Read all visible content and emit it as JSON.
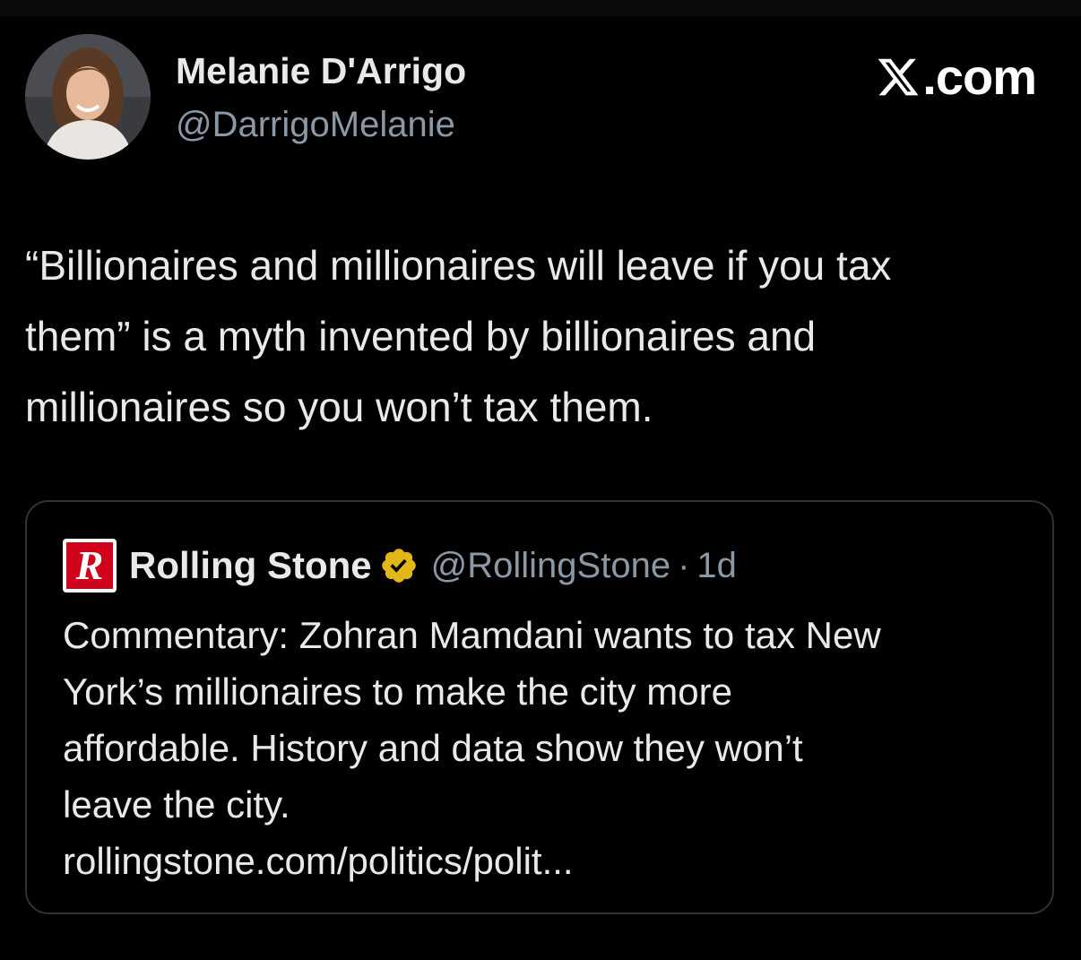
{
  "author": {
    "display_name": "Melanie D'Arrigo",
    "handle": "@DarrigoMelanie",
    "avatar_icon": "profile-photo"
  },
  "brand": {
    "label": ".com",
    "icon": "x-logo-icon"
  },
  "tweet": {
    "lines": [
      "“Billionaires and millionaires will leave if you tax",
      "them” is a myth invented by billionaires and",
      "millionaires so you won’t tax them."
    ]
  },
  "quote": {
    "logo_letter": "R",
    "logo_color": "#d0021b",
    "name": "Rolling Stone",
    "verified_color": "#e2b719",
    "handle": "@RollingStone",
    "separator": "·",
    "time": "1d",
    "lines": [
      "Commentary: Zohran Mamdani wants to tax New",
      "York’s millionaires to make the city more",
      "affordable. History and data show they won’t",
      "leave the city.",
      "rollingstone.com/politics/polit..."
    ]
  },
  "colors": {
    "background": "#000000",
    "text_primary": "#e7e9ea",
    "text_secondary": "#8b98a5",
    "card_border": "#2f3336"
  }
}
